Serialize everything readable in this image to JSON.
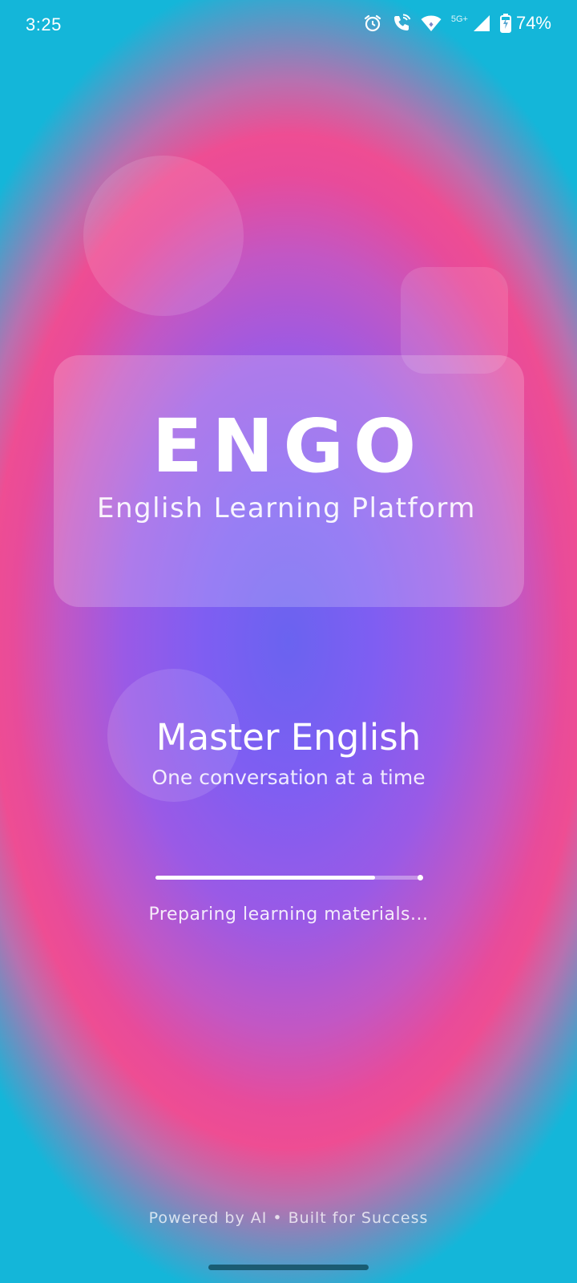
{
  "status_bar": {
    "time": "3:25",
    "network_label": "5G+",
    "battery": "74%",
    "icons": [
      "alarm-icon",
      "wifi-calling-icon",
      "wifi-icon",
      "cell-signal-icon",
      "battery-charging-icon"
    ]
  },
  "brand": {
    "logo_text": "ENGO",
    "tagline": "English Learning Platform"
  },
  "hero": {
    "title": "Master English",
    "subtitle": "One conversation at a time"
  },
  "loading": {
    "progress": 0.82,
    "status_text": "Preparing learning materials..."
  },
  "footer": {
    "text": "Powered by AI • Built for Success"
  },
  "colors": {
    "center": "#6a63f0",
    "pink_ring": "#ee4d93",
    "edge_cyan": "#14b6d9",
    "text": "#ffffff"
  }
}
